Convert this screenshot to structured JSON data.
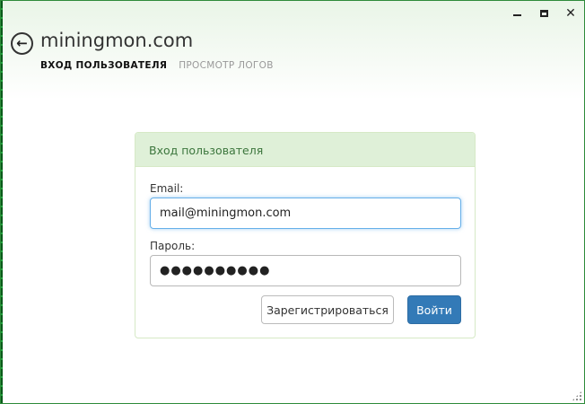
{
  "app": {
    "title": "miningmon.com",
    "back_icon": "arrow-left-icon"
  },
  "window_controls": {
    "minimize_icon": "minimize-icon",
    "maximize_icon": "maximize-icon",
    "close_icon": "close-icon",
    "close_glyph": "✕"
  },
  "nav": {
    "items": [
      {
        "label": "ВХОД ПОЛЬЗОВАТЕЛЯ",
        "active": true
      },
      {
        "label": "ПРОСМОТР ЛОГОВ",
        "active": false
      }
    ]
  },
  "login_panel": {
    "heading": "Вход пользователя",
    "email_label": "Email:",
    "email_value": "mail@miningmon.com",
    "password_label": "Пароль:",
    "password_value": "●●●●●●●●●●",
    "register_button": "Зарегистрироваться",
    "login_button": "Войти"
  },
  "colors": {
    "window_border": "#2e8b3a",
    "panel_heading_bg": "#dff0d8",
    "panel_heading_text": "#3c763d",
    "primary_button": "#337ab7",
    "focus_border": "#66afe9"
  }
}
